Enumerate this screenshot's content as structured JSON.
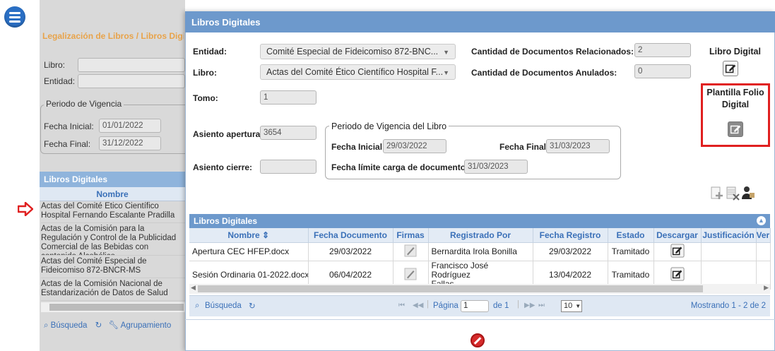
{
  "toolbar": {
    "icons": [
      "menu-icon",
      "add-icon",
      "search-icon",
      "refresh-icon",
      "export-icon",
      "user-icon"
    ]
  },
  "left": {
    "breadcrumb": "Legalización de Libros / Libros Digitales",
    "libro_label": "Libro:",
    "entidad_label": "Entidad:",
    "periodo_legend": "Periodo de Vigencia",
    "fecha_inicial_label": "Fecha Inicial:",
    "fecha_inicial_value": "01/01/2022",
    "fecha_final_label": "Fecha Final:",
    "fecha_final_value": "31/12/2022",
    "grid_title": "Libros Digitales",
    "grid_col": "Nombre",
    "rows": [
      "Actas del Comité Ético Científico Hospital Fernando Escalante Pradilla",
      "Actas de la Comisión para la Regulación y Control de la Publicidad Comercial de las Bebidas con contenido Alcohólico",
      "Actas del Comité Especial de Fideicomiso 872-BNCR-MS",
      "Actas de la Comisión Nacional de Estandarización de Datos de Salud"
    ],
    "footer_search": "Búsqueda",
    "footer_group": "Agrupamiento"
  },
  "dialog": {
    "title": "Libros Digitales",
    "entidad_label": "Entidad:",
    "entidad_value": "Comité Especial de Fideicomiso 872-BNC...",
    "libro_label": "Libro:",
    "libro_value": "Actas del Comité Ético Científico Hospital F...",
    "tomo_label": "Tomo:",
    "tomo_value": "1",
    "cant_rel_label": "Cantidad de Documentos Relacionados:",
    "cant_rel_value": "2",
    "cant_anul_label": "Cantidad de Documentos Anulados:",
    "cant_anul_value": "0",
    "libro_digital_label": "Libro Digital",
    "plantilla_label_1": "Plantilla Folio",
    "plantilla_label_2": "Digital",
    "asiento_apertura_label": "Asiento apertura:",
    "asiento_apertura_value": "3654",
    "asiento_cierre_label": "Asiento cierre:",
    "asiento_cierre_value": "",
    "periodo_legend": "Periodo de Vigencia del Libro",
    "fecha_inicial_label": "Fecha Inicial:",
    "fecha_inicial_value": "29/03/2022",
    "fecha_final_label": "Fecha Final:",
    "fecha_final_value": "31/03/2023",
    "fecha_limite_label": "Fecha límite carga de documentos:",
    "fecha_limite_value": "31/03/2023"
  },
  "grid": {
    "title": "Libros Digitales",
    "columns": [
      "Nombre ⇕",
      "Fecha Documento",
      "Firmas",
      "Registrado Por",
      "Fecha Registro",
      "Estado",
      "Descargar",
      "Justificación",
      "Ver C"
    ],
    "rows": [
      {
        "nombre": "Apertura CEC HFEP.docx",
        "fecha_doc": "29/03/2022",
        "registrado": "Bernardita Irola Bonilla",
        "registrado2": "",
        "fecha_reg": "29/03/2022",
        "estado": "Tramitado"
      },
      {
        "nombre": "Sesión Ordinaria 01-2022.docx",
        "fecha_doc": "06/04/2022",
        "registrado": "Francisco José Rodríguez",
        "registrado2": "Fallas",
        "fecha_reg": "13/04/2022",
        "estado": "Tramitado"
      }
    ],
    "pager": {
      "search": "Búsqueda",
      "page_label": "Página",
      "page_value": "1",
      "of_label": "de 1",
      "per_page": "10",
      "showing": "Mostrando 1 - 2 de 2"
    }
  }
}
